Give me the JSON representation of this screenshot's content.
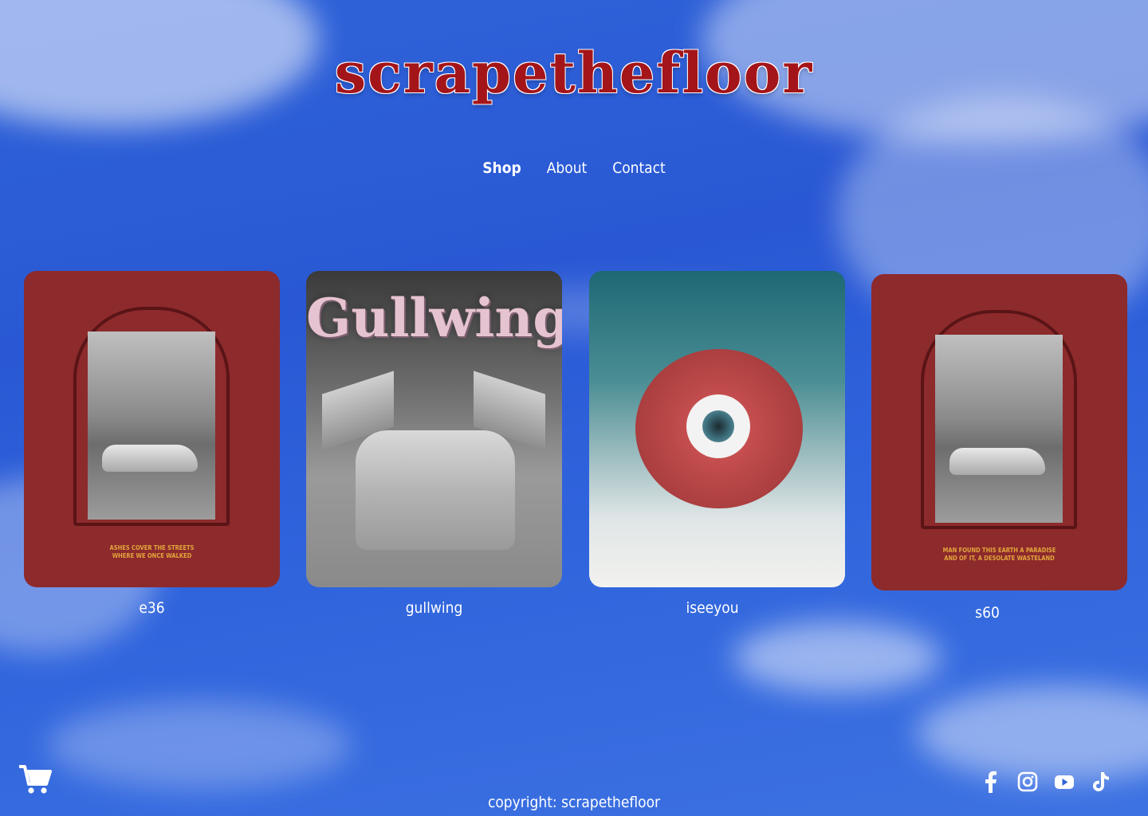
{
  "brand": {
    "logo_text": "scrapethefloor"
  },
  "nav": {
    "items": [
      {
        "label": "Shop",
        "active": true
      },
      {
        "label": "About",
        "active": false
      },
      {
        "label": "Contact",
        "active": false
      }
    ]
  },
  "products": [
    {
      "title": "e36",
      "poster_caption": [
        "ASHES COVER THE STREETS",
        "WHERE WE ONCE WALKED"
      ]
    },
    {
      "title": "gullwing",
      "poster_word": "Gullwing"
    },
    {
      "title": "iseeyou"
    },
    {
      "title": "s60",
      "poster_caption": [
        "MAN FOUND THIS EARTH A PARADISE",
        "AND OF IT, A DESOLATE WASTELAND"
      ]
    }
  ],
  "footer": {
    "copyright": "copyright: scrapethefloor"
  },
  "icons": [
    "cart-icon",
    "facebook-icon",
    "instagram-icon",
    "youtube-icon",
    "tiktok-icon"
  ],
  "colors": {
    "sky_blue": "#2f63d9",
    "brand_red": "#a4151a",
    "poster_red": "#8d2a2c",
    "caption_gold": "#e3a53c"
  }
}
